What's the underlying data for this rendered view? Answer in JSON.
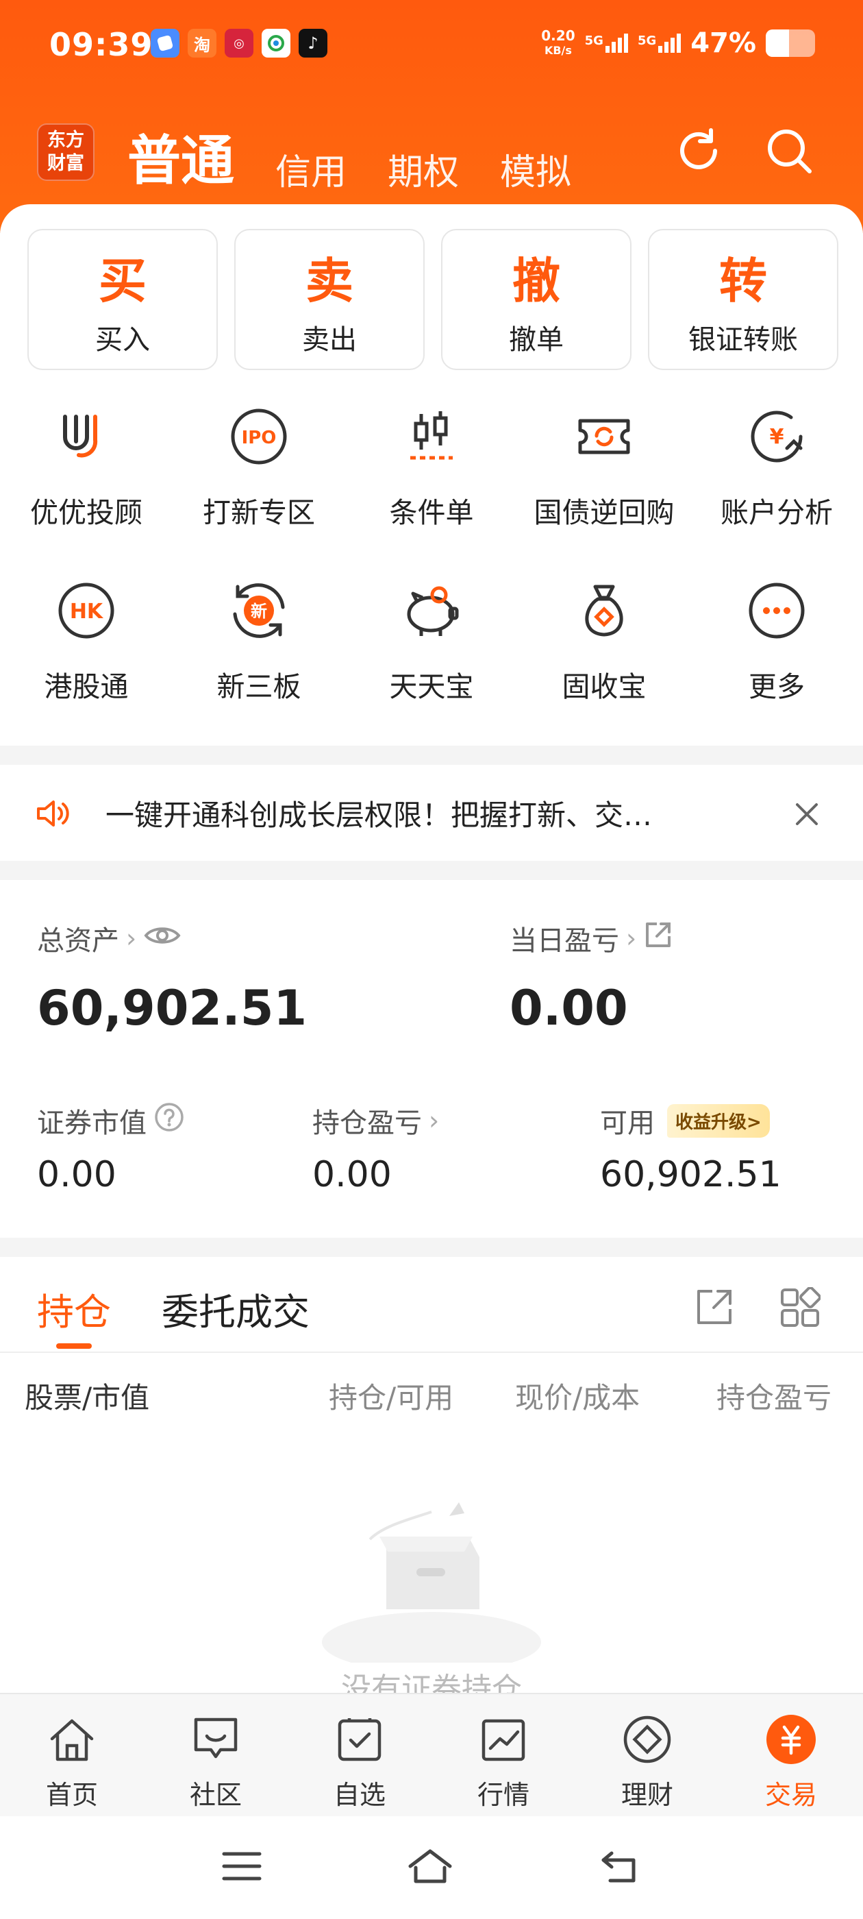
{
  "status_bar": {
    "time": "09:39",
    "speed_value": "0.20",
    "speed_unit": "KB/s",
    "network1": "5G",
    "network2": "5G",
    "battery": "47%",
    "battery_level": 0.47
  },
  "header": {
    "logo_line1": "东方",
    "logo_line2": "财富",
    "tabs": [
      {
        "label": "普通",
        "active": true
      },
      {
        "label": "信用"
      },
      {
        "label": "期权"
      },
      {
        "label": "模拟"
      }
    ],
    "icons": [
      "refresh-icon",
      "search-icon"
    ]
  },
  "trade_buttons": [
    {
      "big": "买",
      "small": "买入"
    },
    {
      "big": "卖",
      "small": "卖出"
    },
    {
      "big": "撤",
      "small": "撤单"
    },
    {
      "big": "转",
      "small": "银证转账"
    }
  ],
  "shortcuts": [
    {
      "label": "优优投顾",
      "icon": "uu-advisor-icon"
    },
    {
      "label": "打新专区",
      "icon": "ipo-icon",
      "icon_text": "IPO"
    },
    {
      "label": "条件单",
      "icon": "candlestick-icon"
    },
    {
      "label": "国债逆回购",
      "icon": "ticket-refresh-icon"
    },
    {
      "label": "账户分析",
      "icon": "yuan-chart-icon",
      "icon_text": "¥"
    },
    {
      "label": "港股通",
      "icon": "hk-icon",
      "icon_text": "HK"
    },
    {
      "label": "新三板",
      "icon": "new-board-icon",
      "icon_text": "新"
    },
    {
      "label": "天天宝",
      "icon": "piggy-bank-icon"
    },
    {
      "label": "固收宝",
      "icon": "money-bag-icon"
    },
    {
      "label": "更多",
      "icon": "more-icon"
    }
  ],
  "notice": {
    "text": "一键开通科创成长层权限！把握打新、交…"
  },
  "assets": {
    "total_label": "总资产",
    "total_value": "60,902.51",
    "daily_pl_label": "当日盈亏",
    "daily_pl_value": "0.00",
    "market_value_label": "证券市值",
    "market_value": "0.00",
    "position_pl_label": "持仓盈亏",
    "position_pl_value": "0.00",
    "available_label": "可用",
    "available_badge": "收益升级>",
    "available_value": "60,902.51"
  },
  "holdings": {
    "tabs": [
      "持仓",
      "委托成交"
    ],
    "columns": [
      "股票/市值",
      "持仓/可用",
      "现价/成本",
      "持仓盈亏"
    ],
    "empty_text": "没有证券持仓"
  },
  "bottom_nav": [
    {
      "label": "首页",
      "icon": "home-icon"
    },
    {
      "label": "社区",
      "icon": "community-icon"
    },
    {
      "label": "自选",
      "icon": "watchlist-icon"
    },
    {
      "label": "行情",
      "icon": "market-icon"
    },
    {
      "label": "理财",
      "icon": "wealth-icon"
    },
    {
      "label": "交易",
      "icon": "trade-icon",
      "active": true
    }
  ],
  "colors": {
    "brand": "#ff5a0e",
    "text": "#222222",
    "muted": "#888888"
  }
}
